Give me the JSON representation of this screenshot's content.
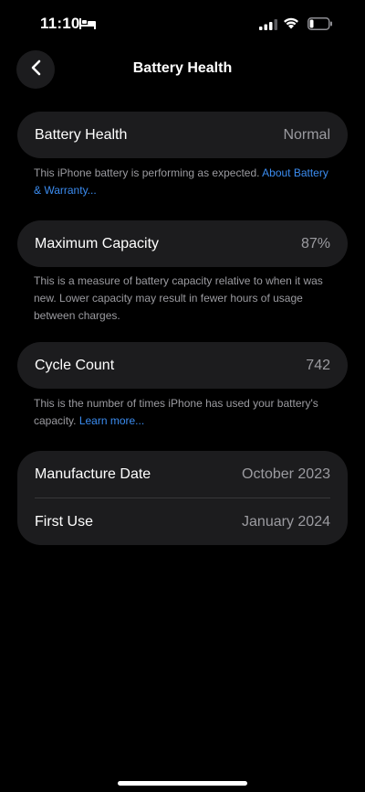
{
  "status_bar": {
    "time": "11:10",
    "sleep_icon": "bed-icon",
    "signal_icon": "cellular-signal-icon",
    "wifi_icon": "wifi-icon",
    "battery_icon": "battery-low-icon"
  },
  "nav": {
    "back_icon": "chevron-left-icon",
    "title": "Battery Health"
  },
  "battery_health": {
    "label": "Battery Health",
    "value": "Normal",
    "note": "This iPhone battery is performing as expected.",
    "note_link": "About Battery & Warranty..."
  },
  "max_capacity": {
    "label": "Maximum Capacity",
    "value": "87%",
    "note": "This is a measure of battery capacity relative to when it was new. Lower capacity may result in fewer hours of usage between charges."
  },
  "cycle_count": {
    "label": "Cycle Count",
    "value": "742",
    "note": "This is the number of times iPhone has used your battery's capacity.",
    "note_link": "Learn more..."
  },
  "dates": {
    "manufacture_label": "Manufacture Date",
    "manufacture_value": "October 2023",
    "first_use_label": "First Use",
    "first_use_value": "January 2024"
  },
  "colors": {
    "background": "#000000",
    "card": "#1c1c1e",
    "secondary_text": "#9b9ba0",
    "link": "#3b8cf0"
  }
}
